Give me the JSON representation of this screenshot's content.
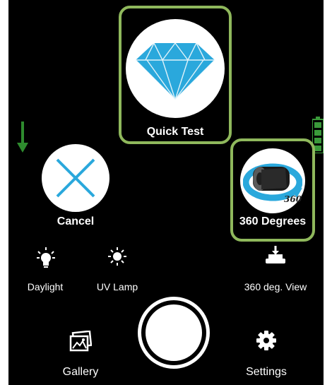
{
  "buttons": {
    "quick_test": "Quick Test",
    "cancel": "Cancel",
    "degrees_360": "360 Degrees"
  },
  "modes": {
    "daylight": "Daylight",
    "uv_lamp": "UV Lamp",
    "view_360": "360 deg. View"
  },
  "bottom": {
    "gallery": "Gallery",
    "settings": "Settings"
  },
  "badge_360": "360",
  "colors": {
    "highlight": "#8fb85c",
    "accent_blue": "#2aa8dc",
    "arrow_green": "#2e8b2e",
    "battery_green": "#3a9a3a"
  },
  "icons": {
    "quick_test": "diamond-icon",
    "cancel": "x-icon",
    "degrees_360": "rotate-360-icon",
    "daylight": "bulb-icon",
    "uv_lamp": "sun-icon",
    "view_360": "turntable-icon",
    "gallery": "gallery-icon",
    "settings": "gear-icon",
    "capture": "shutter-button",
    "arrow": "down-arrow-icon",
    "battery": "battery-icon"
  }
}
